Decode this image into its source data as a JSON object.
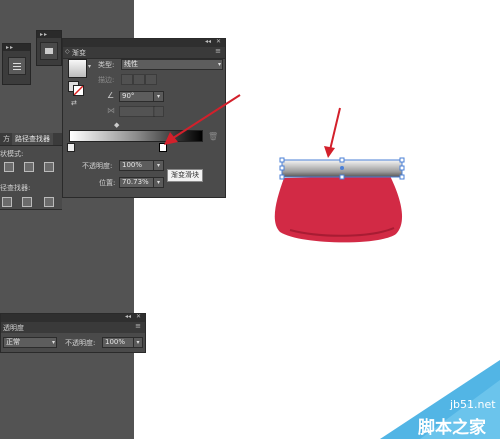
{
  "pathfinder_panel": {
    "tab_left": "方",
    "tab_right": "路径查找器",
    "shape_modes_label": "状模式:",
    "pathfinder_label": "径查找器:"
  },
  "gradient_panel": {
    "tab_label": "渐变",
    "type_label": "类型:",
    "type_value": "线性",
    "stroke_label": "描边:",
    "angle_value": "90°",
    "opacity_label": "不透明度:",
    "opacity_value": "100%",
    "location_label": "位置:",
    "location_value": "70.73%"
  },
  "tooltip": {
    "text": "渐变滑块"
  },
  "transparency_panel": {
    "tab_label": "透明度",
    "blend_value": "正常",
    "opacity_label": "不透明度:",
    "opacity_value": "100%"
  },
  "watermark": {
    "site": "jb51.net",
    "name": "脚本之家"
  },
  "colors": {
    "shape_red": "#d22a45",
    "arrow_red": "#d3202b",
    "watermark_blue": "#34a8e0"
  }
}
